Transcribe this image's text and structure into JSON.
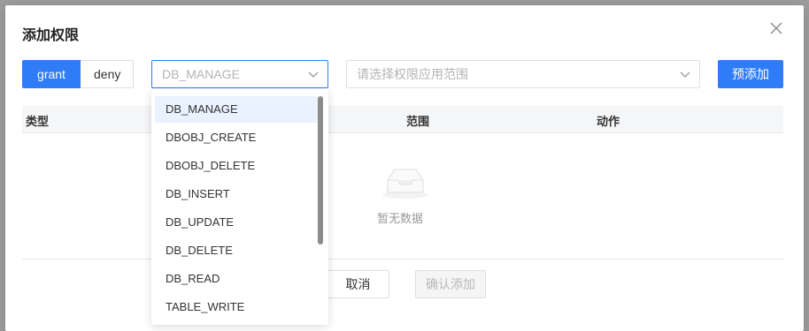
{
  "dialog": {
    "title": "添加权限",
    "close_icon": "close-icon"
  },
  "toolbar": {
    "grant_label": "grant",
    "deny_label": "deny",
    "permission_select": {
      "placeholder": "DB_MANAGE",
      "icon": "chevron-down-icon"
    },
    "scope_select": {
      "placeholder": "请选择权限应用范围",
      "icon": "chevron-down-icon"
    },
    "pre_add_label": "预添加"
  },
  "table": {
    "columns": [
      "类型",
      "范围",
      "动作"
    ],
    "empty_text": "暂无数据",
    "empty_icon": "empty-inbox-icon"
  },
  "footer": {
    "cancel_label": "取消",
    "confirm_label": "确认添加"
  },
  "dropdown": {
    "selected": "DB_MANAGE",
    "options": [
      "DB_MANAGE",
      "DBOBJ_CREATE",
      "DBOBJ_DELETE",
      "DB_INSERT",
      "DB_UPDATE",
      "DB_DELETE",
      "DB_READ",
      "TABLE_WRITE"
    ]
  },
  "colors": {
    "primary": "#2f7cf6",
    "selected_option_bg": "#e9f2fe"
  }
}
